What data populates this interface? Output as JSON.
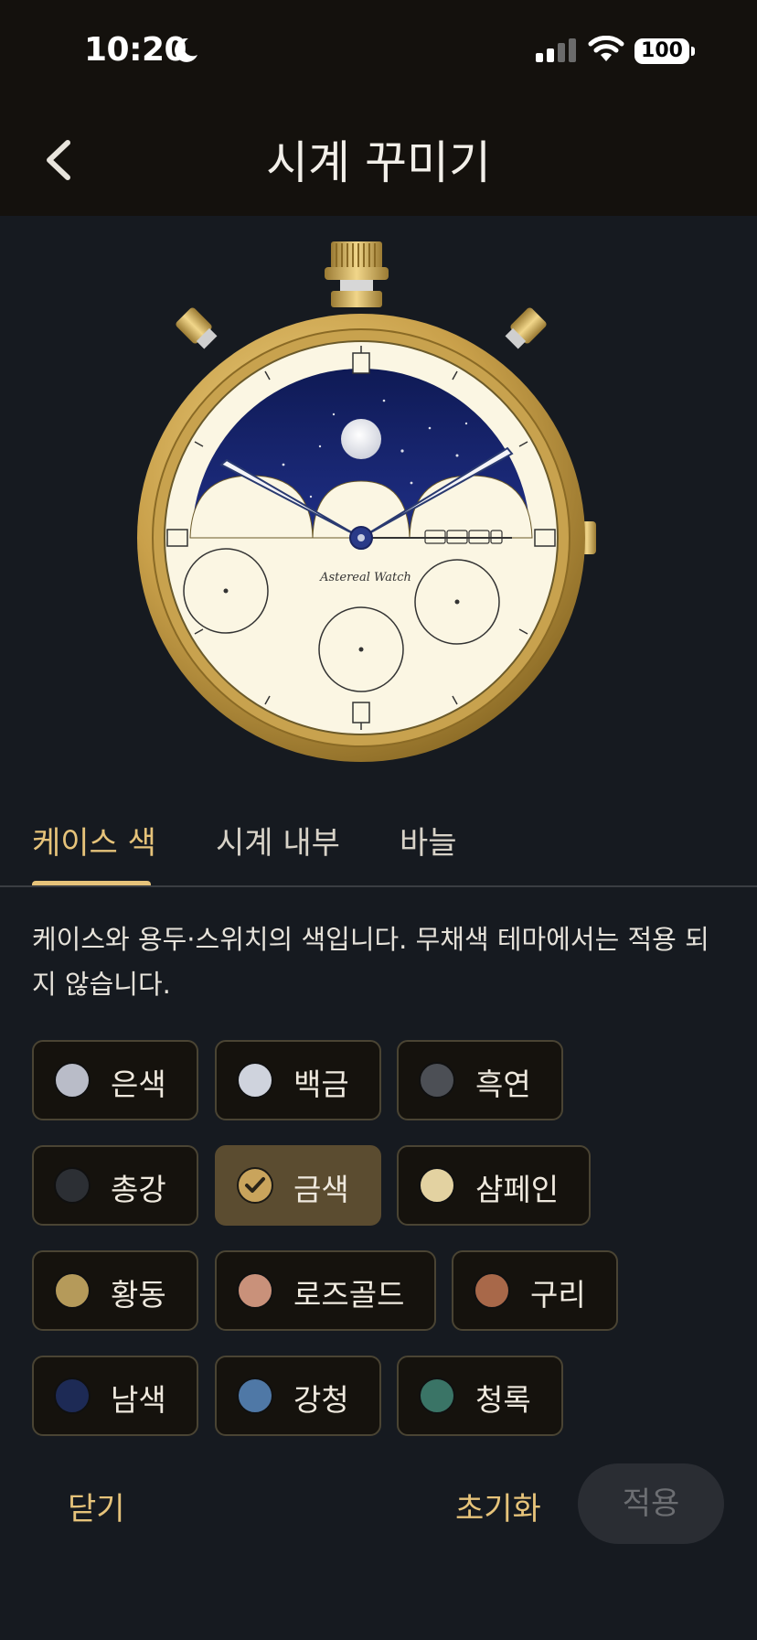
{
  "status_bar": {
    "time": "10:20",
    "battery": "100"
  },
  "header": {
    "title": "시계 꾸미기"
  },
  "watch": {
    "brand": "Astereal Watch"
  },
  "tabs": [
    {
      "label": "케이스 색",
      "active": true
    },
    {
      "label": "시계 내부",
      "active": false
    },
    {
      "label": "바늘",
      "active": false
    }
  ],
  "description": "케이스와 용두·스위치의 색입니다. 무채색 테마에서는 적용 되지 않습니다.",
  "colors": [
    {
      "label": "은색",
      "color": "#b9bcc8",
      "selected": false
    },
    {
      "label": "백금",
      "color": "#cfd3dd",
      "selected": false
    },
    {
      "label": "흑연",
      "color": "#4c4f55",
      "selected": false
    },
    {
      "label": "총강",
      "color": "#2c2f34",
      "selected": false
    },
    {
      "label": "금색",
      "color": "#c9a45c",
      "selected": true
    },
    {
      "label": "샴페인",
      "color": "#e3d2a1",
      "selected": false
    },
    {
      "label": "황동",
      "color": "#b59a5a",
      "selected": false
    },
    {
      "label": "로즈골드",
      "color": "#c9917a",
      "selected": false
    },
    {
      "label": "구리",
      "color": "#a86849",
      "selected": false
    },
    {
      "label": "남색",
      "color": "#1d2a55",
      "selected": false
    },
    {
      "label": "강청",
      "color": "#4f78a6",
      "selected": false
    },
    {
      "label": "청록",
      "color": "#3a7466",
      "selected": false
    }
  ],
  "footer": {
    "close": "닫기",
    "reset": "초기화",
    "apply": "적용"
  },
  "theme": {
    "accent": "#e6c37a",
    "background": "#161a20"
  }
}
